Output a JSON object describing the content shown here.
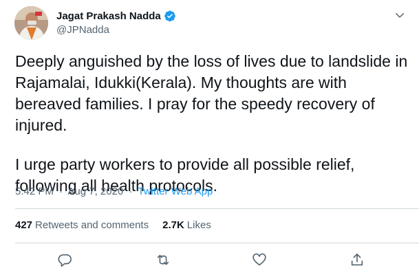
{
  "author": {
    "name": "Jagat Prakash Nadda",
    "handle": "@JPNadda"
  },
  "tweet": {
    "paragraphs": [
      "Deeply anguished by the loss of lives due to landslide in Rajamalai, Idukki(Kerala). My thoughts are with bereaved families. I pray for the speedy recovery of injured.",
      "I urge party workers to provide all possible relief, following all health protocols."
    ],
    "time": "5:42 PM",
    "date": "Aug 7, 2020",
    "separator": "·",
    "source": "Twitter Web App"
  },
  "stats": {
    "retweets_count": "427",
    "retweets_label": "Retweets and comments",
    "likes_count": "2.7K",
    "likes_label": "Likes"
  },
  "icons": {
    "verified": "verified-badge-icon",
    "menu": "chevron-down-icon",
    "reply": "reply-icon",
    "retweet": "retweet-icon",
    "like": "heart-icon",
    "share": "share-icon"
  },
  "colors": {
    "text": "#0f1419",
    "secondary": "#536471",
    "accent": "#1d9bf0",
    "divider": "#cfd9de"
  }
}
